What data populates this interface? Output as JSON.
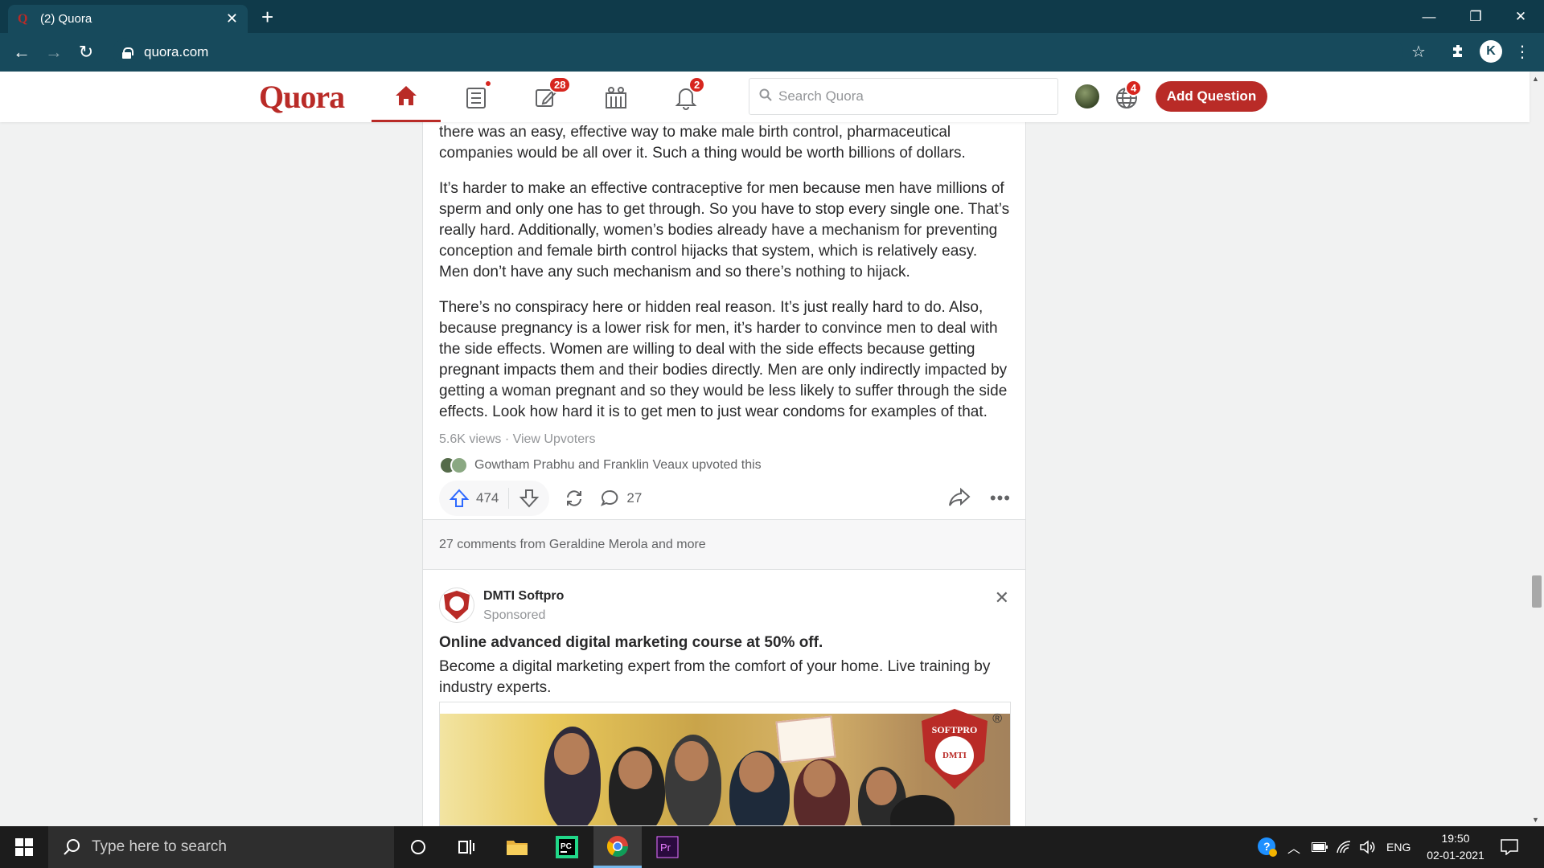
{
  "browser": {
    "tab_title": "(2) Quora",
    "url": "quora.com"
  },
  "quora": {
    "logo": "Quora",
    "badges": {
      "answer": "28",
      "notifications": "2",
      "language": "4"
    },
    "search_placeholder": "Search Quora",
    "add_question": "Add Question"
  },
  "answer": {
    "paragraphs": [
      "there was an easy, effective way to make male birth control, pharmaceutical companies would be all over it. Such a thing would be worth billions of dollars.",
      "It’s harder to make an effective contraceptive for men because men have millions of sperm and only one has to get through. So you have to stop every single one. That’s really hard. Additionally, women’s bodies already have a mechanism for preventing conception and female birth control hijacks that system, which is relatively easy. Men don’t have any such mechanism and so there’s nothing to hijack.",
      "There’s no conspiracy here or hidden real reason. It’s just really hard to do. Also, because pregnancy is a lower risk for men, it’s harder to convince men to deal with the side effects. Women are willing to deal with the side effects because getting pregnant impacts them and their bodies directly. Men are only indirectly impacted by getting a woman pregnant and so they would be less likely to suffer through the side effects. Look how hard it is to get men to just wear condoms for examples of that."
    ],
    "views": "5.6K views",
    "separator": " · ",
    "view_upvoters": "View Upvoters",
    "upvoted_by": "Gowtham Prabhu and Franklin Veaux upvoted this",
    "upvotes": "474",
    "comments": "27",
    "comments_row": "27 comments from Geraldine Merola and more"
  },
  "ad": {
    "name": "DMTI Softpro",
    "sponsored": "Sponsored",
    "title": "Online advanced digital marketing course at 50% off.",
    "description": "Become a digital marketing expert from the comfort of your home. Live training by industry experts.",
    "shield_top": "SOFTPRO",
    "shield_mid": "DMTI",
    "registered": "®"
  },
  "taskbar": {
    "search_placeholder": "Type here to search",
    "language": "ENG",
    "time": "19:50",
    "date": "02-01-2021"
  },
  "colors": {
    "brand": "#b92b27",
    "badge": "#d7261f",
    "chrome_dark": "#0f3a4a",
    "chrome": "#174a5c"
  }
}
